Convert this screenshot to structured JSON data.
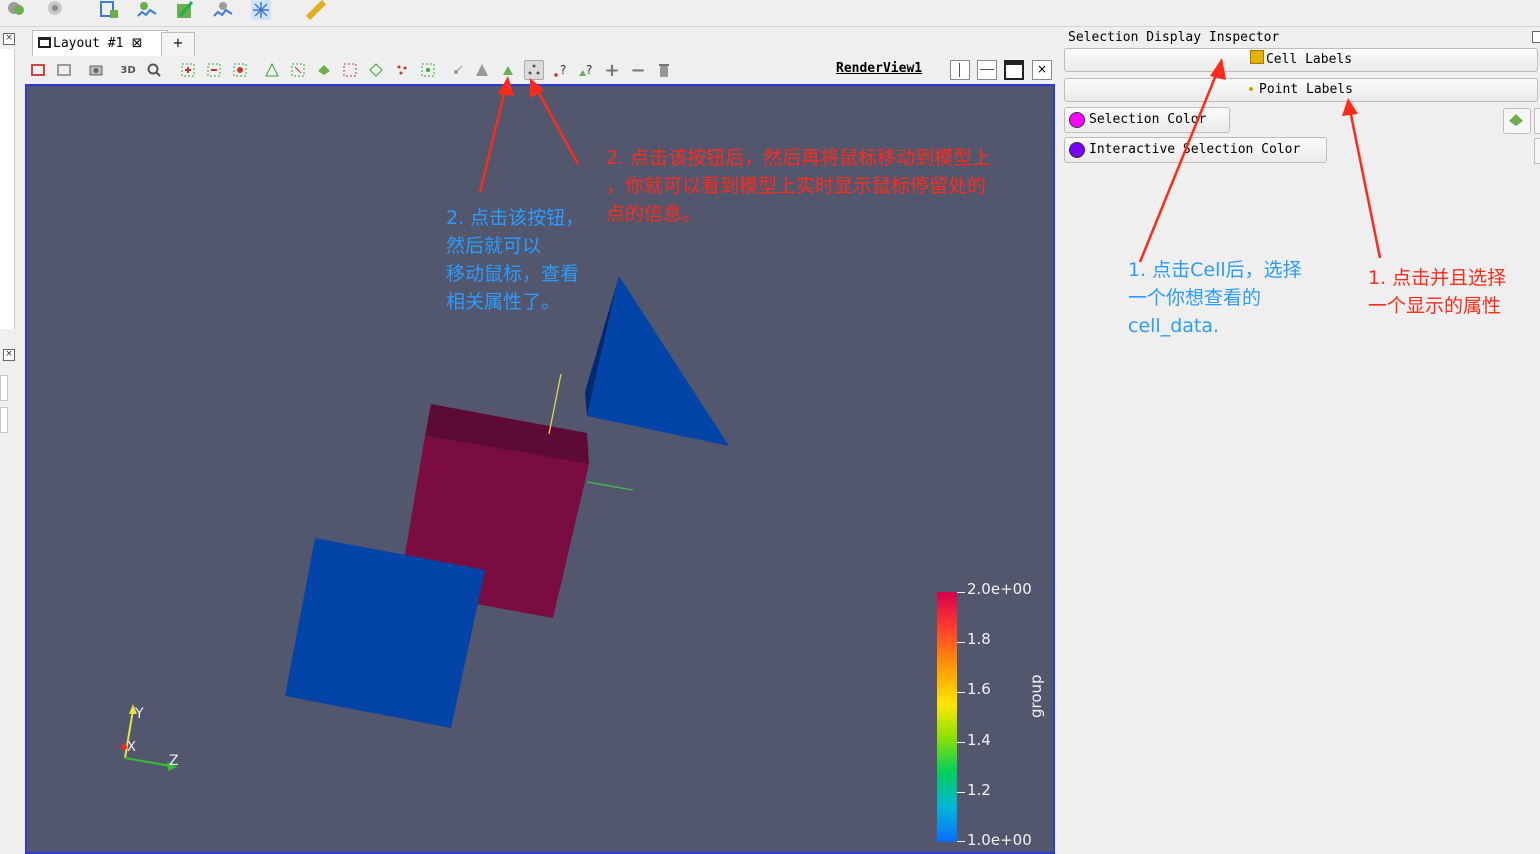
{
  "layout_tab": {
    "label": "Layout #1",
    "close_symbol": "⊠",
    "add_symbol": "+"
  },
  "view_toolbar": {
    "renderview_label": "RenderView1",
    "mode_3d": "3D",
    "query_label": "?"
  },
  "inspector": {
    "title": "Selection Display Inspector",
    "cell_labels": "Cell Labels",
    "point_labels": "Point Labels",
    "selection_color": {
      "label": "Selection Color",
      "color": "#ff00ff"
    },
    "interactive_selection_color": {
      "label": "Interactive Selection Color",
      "color": "#7b00ff"
    }
  },
  "scalar_bar": {
    "title": "group",
    "labels": [
      "2.0e+00",
      "1.8",
      "1.6",
      "1.4",
      "1.2",
      "1.0e+00"
    ]
  },
  "axes": {
    "x": "X",
    "y": "Y",
    "z": "Z"
  },
  "annotations": {
    "blue_left": [
      "2. 点击该按钮，",
      "然后就可以",
      "移动鼠标，查看",
      "相关属性了。"
    ],
    "red_center": [
      "2. 点击该按钮后，然后再将鼠标移动到模型上",
      "，你就可以看到模型上实时显示鼠标停留处的",
      "点的信息。"
    ],
    "blue_right": [
      "1. 点击Cell后，选择",
      "一个你想查看的",
      "cell_data."
    ],
    "red_right": [
      "1. 点击并且选择",
      "一个显示的属性"
    ]
  },
  "colors": {
    "render_bg": "#52576e",
    "view_border": "#2a3bd6",
    "cube_front": "#0344a8",
    "cube_back": "#7a0c42",
    "pyramid": "#0344a8",
    "annotation_red": "#ff2a1a",
    "annotation_blue": "#2a9bff"
  }
}
